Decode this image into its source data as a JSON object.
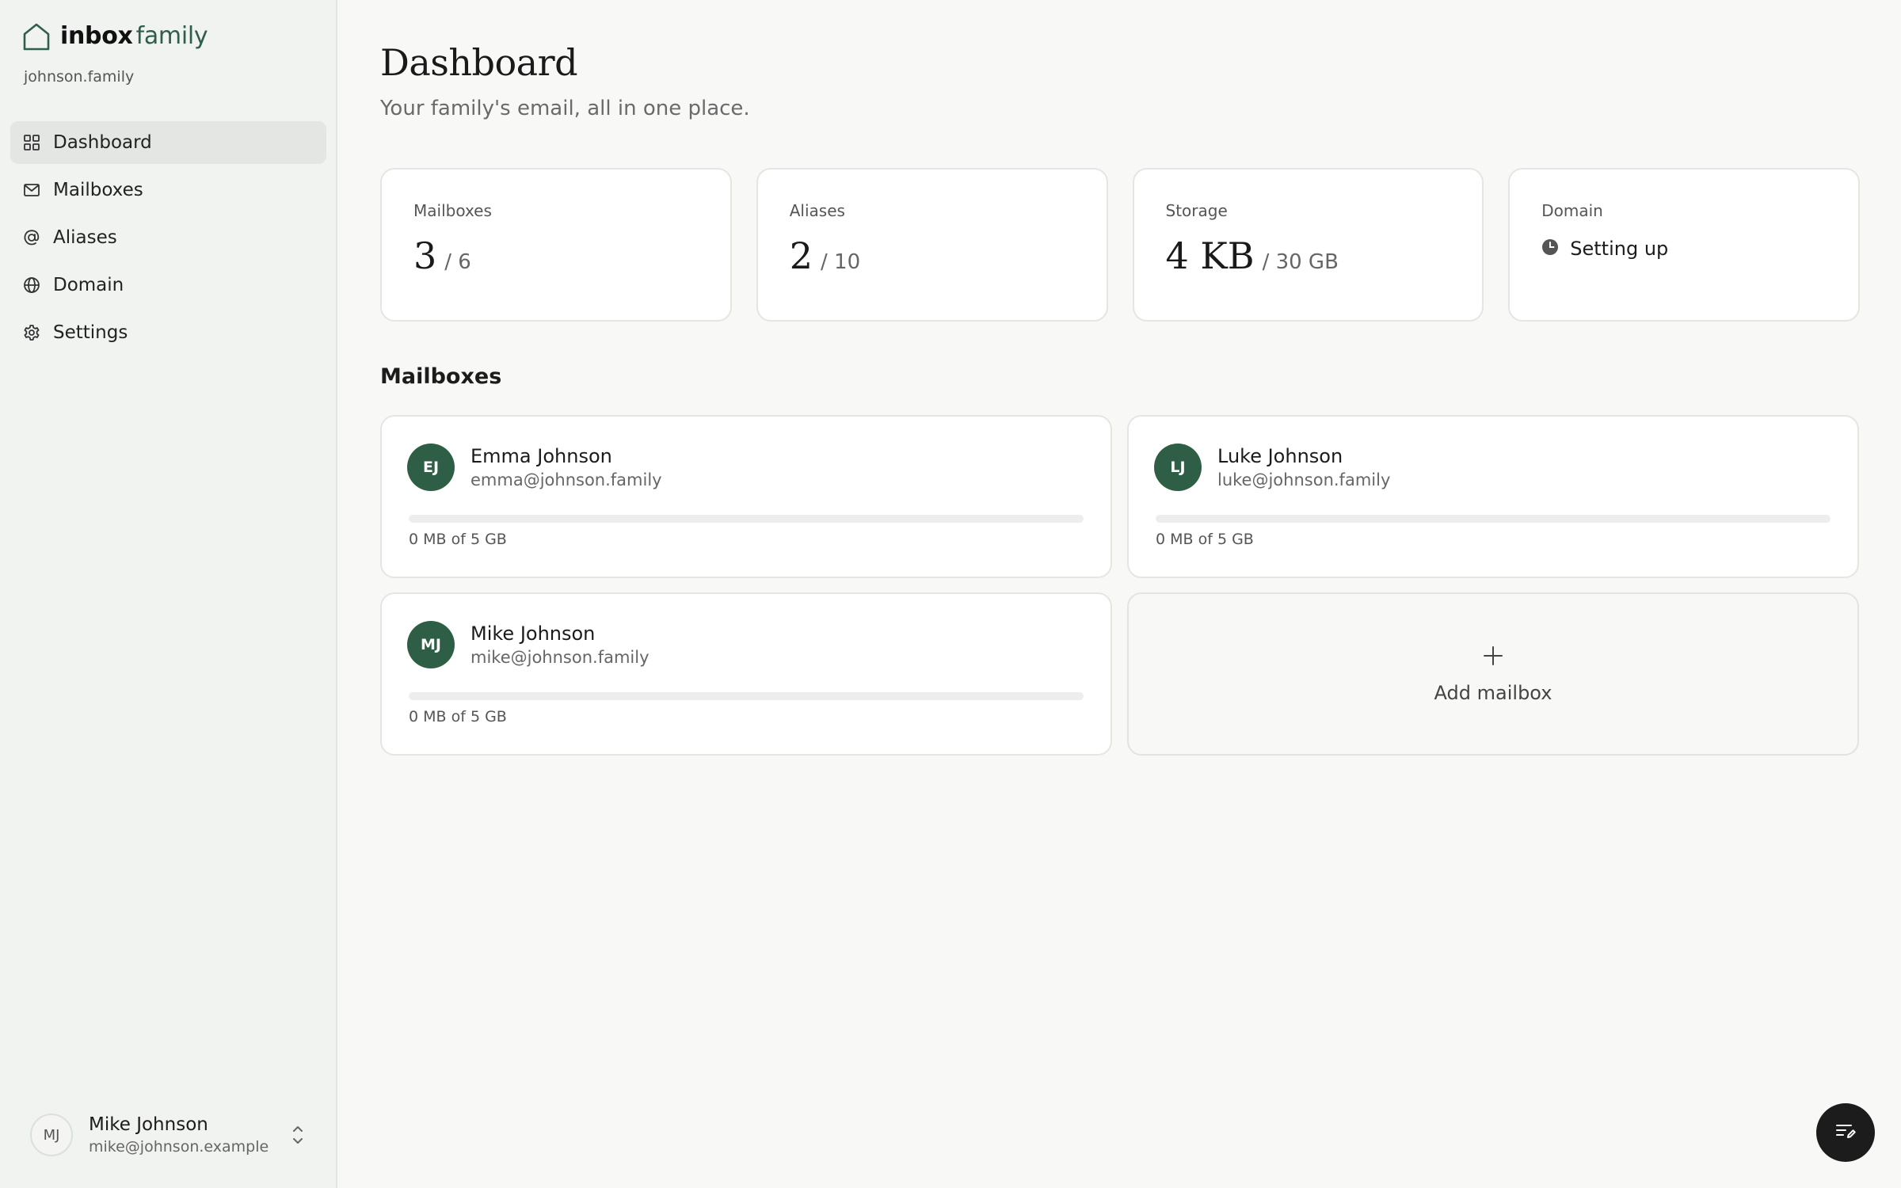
{
  "brand": {
    "bold": "inbox",
    "light": "family"
  },
  "workspace": "johnson.family",
  "nav": [
    {
      "label": "Dashboard",
      "icon": "grid-icon",
      "active": true
    },
    {
      "label": "Mailboxes",
      "icon": "mail-icon",
      "active": false
    },
    {
      "label": "Aliases",
      "icon": "at-sign-icon",
      "active": false
    },
    {
      "label": "Domain",
      "icon": "globe-icon",
      "active": false
    },
    {
      "label": "Settings",
      "icon": "gear-icon",
      "active": false
    }
  ],
  "user": {
    "initials": "MJ",
    "name": "Mike Johnson",
    "email": "mike@johnson.example"
  },
  "page": {
    "title": "Dashboard",
    "subtitle": "Your family's email, all in one place."
  },
  "stats": {
    "mailboxes": {
      "label": "Mailboxes",
      "value": "3",
      "max": "/ 6"
    },
    "aliases": {
      "label": "Aliases",
      "value": "2",
      "max": "/ 10"
    },
    "storage": {
      "label": "Storage",
      "value": "4 KB",
      "max": "/ 30 GB"
    },
    "domain": {
      "label": "Domain",
      "status": "Setting up",
      "status_icon": "clock-icon"
    }
  },
  "mailboxes_section": {
    "title": "Mailboxes",
    "add_label": "Add mailbox"
  },
  "mailboxes": [
    {
      "initials": "EJ",
      "name": "Emma Johnson",
      "email": "emma@johnson.family",
      "usage": "0 MB of 5 GB",
      "usage_fraction": 0
    },
    {
      "initials": "LJ",
      "name": "Luke Johnson",
      "email": "luke@johnson.family",
      "usage": "0 MB of 5 GB",
      "usage_fraction": 0
    },
    {
      "initials": "MJ",
      "name": "Mike Johnson",
      "email": "mike@johnson.family",
      "usage": "0 MB of 5 GB",
      "usage_fraction": 0
    }
  ],
  "colors": {
    "accent": "#2e5e45",
    "sidebar_bg": "#f1f3f0",
    "page_bg": "#f8f8f6",
    "fab_bg": "#1c1c1c"
  }
}
